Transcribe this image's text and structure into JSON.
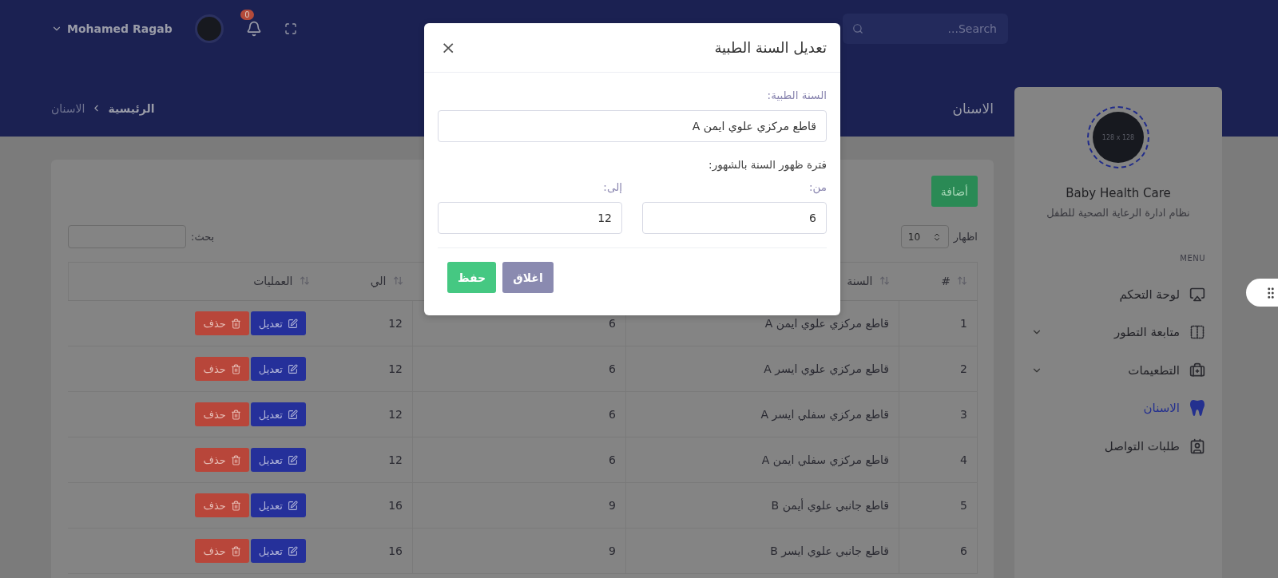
{
  "topbar": {
    "search": {
      "placeholder": "Search..."
    },
    "notifications": {
      "count": "0"
    },
    "user": {
      "name": "Mohamed Ragab"
    }
  },
  "page_header": {
    "title": "الاسنان",
    "breadcrumb": [
      {
        "label": "الرئيسية",
        "current": false
      },
      {
        "label": "الاسنان",
        "current": true
      }
    ]
  },
  "sidebar": {
    "logo_text": "128 x 128",
    "app_name": "Baby Health Care",
    "app_subtitle": "نظام ادارة الرعاية الصحية للطفل",
    "menu_heading": "MENU",
    "items": [
      {
        "label": "لوحة التحكم",
        "expandable": false,
        "selected": false
      },
      {
        "label": "متابعة التطور",
        "expandable": true,
        "selected": false
      },
      {
        "label": "التطعيمات",
        "expandable": true,
        "selected": false
      },
      {
        "label": "الاسنان",
        "expandable": false,
        "selected": true
      },
      {
        "label": "طلبات التواصل",
        "expandable": false,
        "selected": false
      }
    ]
  },
  "table_card": {
    "add_button": "أضافة",
    "length": {
      "label": "اظهار",
      "value": "10"
    },
    "search": {
      "label": "بحث:"
    },
    "columns": [
      "#",
      "السنة",
      null,
      "الي",
      "العمليات"
    ],
    "rows": [
      {
        "number": "1",
        "tooth": "قاطع مركزي علوي ايمن A",
        "from": "6",
        "to": "12",
        "edit_label": "تعديل",
        "delete_label": "حذف"
      },
      {
        "number": "2",
        "tooth": "قاطع مركزي علوي ايسر A",
        "from": "6",
        "to": "12",
        "edit_label": "تعديل",
        "delete_label": "حذف"
      },
      {
        "number": "3",
        "tooth": "قاطع مركزي سفلي ايسر A",
        "from": "6",
        "to": "12",
        "edit_label": "تعديل",
        "delete_label": "حذف"
      },
      {
        "number": "4",
        "tooth": "قاطع مركزي سفلي ايمن A",
        "from": "6",
        "to": "12",
        "edit_label": "تعديل",
        "delete_label": "حذف"
      },
      {
        "number": "5",
        "tooth": "قاطع جانبي علوي أيمن B",
        "from": "9",
        "to": "16",
        "edit_label": "تعديل",
        "delete_label": "حذف"
      },
      {
        "number": "6",
        "tooth": "قاطع جانبي علوي ايسر B",
        "from": "9",
        "to": "16",
        "edit_label": "تعديل",
        "delete_label": "حذف"
      }
    ]
  },
  "modal": {
    "title": "تعديل السنة الطبية",
    "close": "×",
    "tooth_label": "السنة الطبية:",
    "tooth_value": "قاطع مركزي علوي ايمن A",
    "period_label": "فترة ظهور السنة بالشهور:",
    "from_label": "من:",
    "from_value": "6",
    "to_label": "إلى:",
    "to_value": "12",
    "save_button": "حفظ",
    "close_button": "اغلاق"
  }
}
